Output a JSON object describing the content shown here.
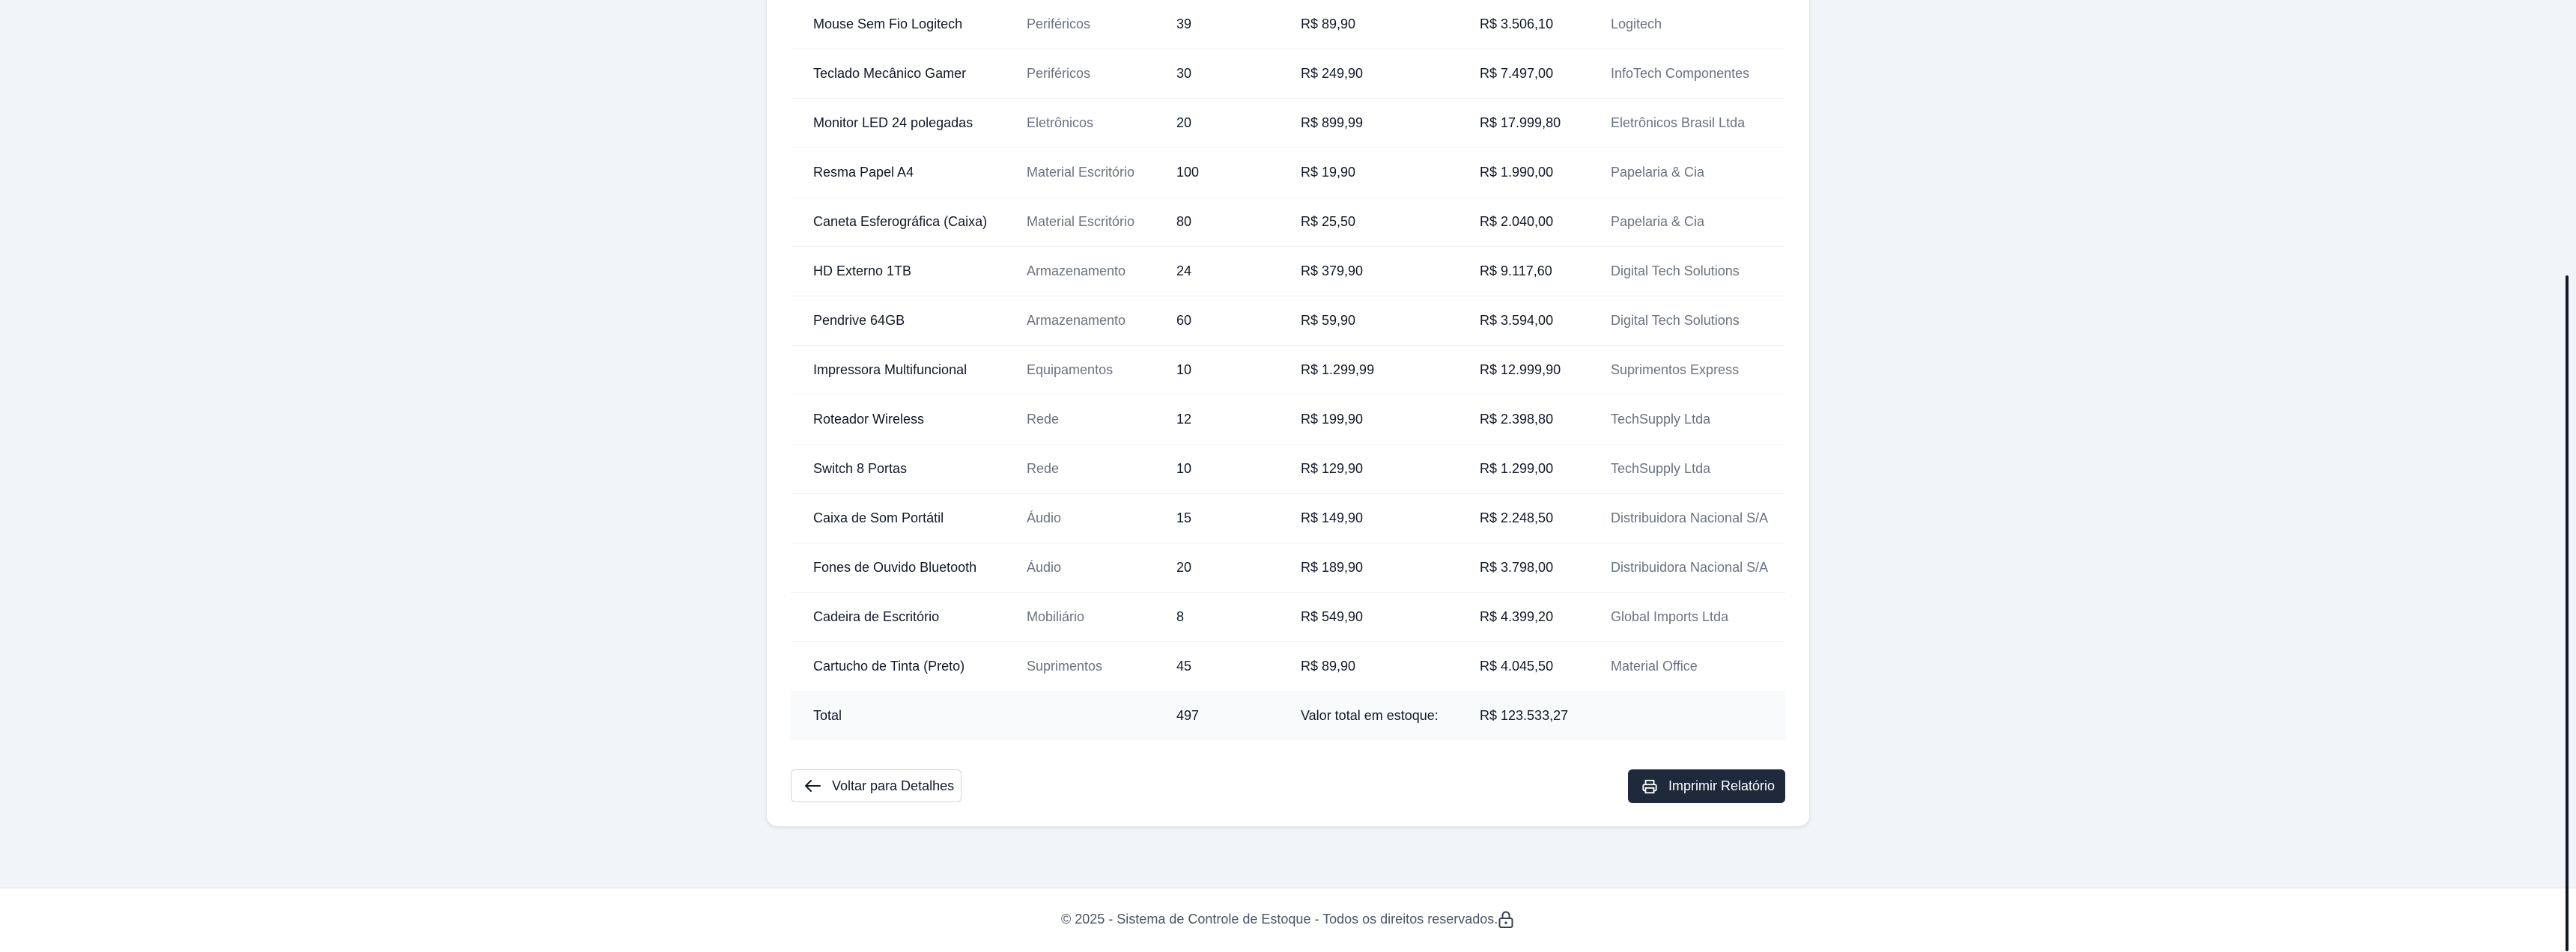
{
  "table": {
    "rows": [
      {
        "name": "Mouse Sem Fio Logitech",
        "category": "Periféricos",
        "qty": "39",
        "unit_price": "R$ 89,90",
        "total": "R$ 3.506,10",
        "supplier": "Logitech"
      },
      {
        "name": "Teclado Mecânico Gamer",
        "category": "Periféricos",
        "qty": "30",
        "unit_price": "R$ 249,90",
        "total": "R$ 7.497,00",
        "supplier": "InfoTech Componentes"
      },
      {
        "name": "Monitor LED 24 polegadas",
        "category": "Eletrônicos",
        "qty": "20",
        "unit_price": "R$ 899,99",
        "total": "R$ 17.999,80",
        "supplier": "Eletrônicos Brasil Ltda"
      },
      {
        "name": "Resma Papel A4",
        "category": "Material Escritório",
        "qty": "100",
        "unit_price": "R$ 19,90",
        "total": "R$ 1.990,00",
        "supplier": "Papelaria & Cia"
      },
      {
        "name": "Caneta Esferográfica (Caixa)",
        "category": "Material Escritório",
        "qty": "80",
        "unit_price": "R$ 25,50",
        "total": "R$ 2.040,00",
        "supplier": "Papelaria & Cia"
      },
      {
        "name": "HD Externo 1TB",
        "category": "Armazenamento",
        "qty": "24",
        "unit_price": "R$ 379,90",
        "total": "R$ 9.117,60",
        "supplier": "Digital Tech Solutions"
      },
      {
        "name": "Pendrive 64GB",
        "category": "Armazenamento",
        "qty": "60",
        "unit_price": "R$ 59,90",
        "total": "R$ 3.594,00",
        "supplier": "Digital Tech Solutions"
      },
      {
        "name": "Impressora Multifuncional",
        "category": "Equipamentos",
        "qty": "10",
        "unit_price": "R$ 1.299,99",
        "total": "R$ 12.999,90",
        "supplier": "Suprimentos Express"
      },
      {
        "name": "Roteador Wireless",
        "category": "Rede",
        "qty": "12",
        "unit_price": "R$ 199,90",
        "total": "R$ 2.398,80",
        "supplier": "TechSupply Ltda"
      },
      {
        "name": "Switch 8 Portas",
        "category": "Rede",
        "qty": "10",
        "unit_price": "R$ 129,90",
        "total": "R$ 1.299,00",
        "supplier": "TechSupply Ltda"
      },
      {
        "name": "Caixa de Som Portátil",
        "category": "Áudio",
        "qty": "15",
        "unit_price": "R$ 149,90",
        "total": "R$ 2.248,50",
        "supplier": "Distribuidora Nacional S/A"
      },
      {
        "name": "Fones de Ouvido Bluetooth",
        "category": "Áudio",
        "qty": "20",
        "unit_price": "R$ 189,90",
        "total": "R$ 3.798,00",
        "supplier": "Distribuidora Nacional S/A"
      },
      {
        "name": "Cadeira de Escritório",
        "category": "Mobiliário",
        "qty": "8",
        "unit_price": "R$ 549,90",
        "total": "R$ 4.399,20",
        "supplier": "Global Imports Ltda"
      },
      {
        "name": "Cartucho de Tinta (Preto)",
        "category": "Suprimentos",
        "qty": "45",
        "unit_price": "R$ 89,90",
        "total": "R$ 4.045,50",
        "supplier": "Material Office"
      }
    ],
    "total_row": {
      "label": "Total",
      "qty": "497",
      "value_label": "Valor total em estoque:",
      "value": "R$ 123.533,27"
    }
  },
  "actions": {
    "back_label": "Voltar para Detalhes",
    "back_icon": "arrow-left-icon",
    "print_label": "Imprimir Relatório",
    "print_icon": "printer-icon"
  },
  "footer": {
    "text": "© 2025 - Sistema de Controle de Estoque - Todos os direitos reservados.",
    "icon": "lock-icon"
  },
  "colors": {
    "page_bg": "#f1f5f9",
    "card_bg": "#ffffff",
    "primary_button": "#1e293b",
    "muted_text": "#6b7280",
    "total_row_bg": "#f8fafc"
  }
}
